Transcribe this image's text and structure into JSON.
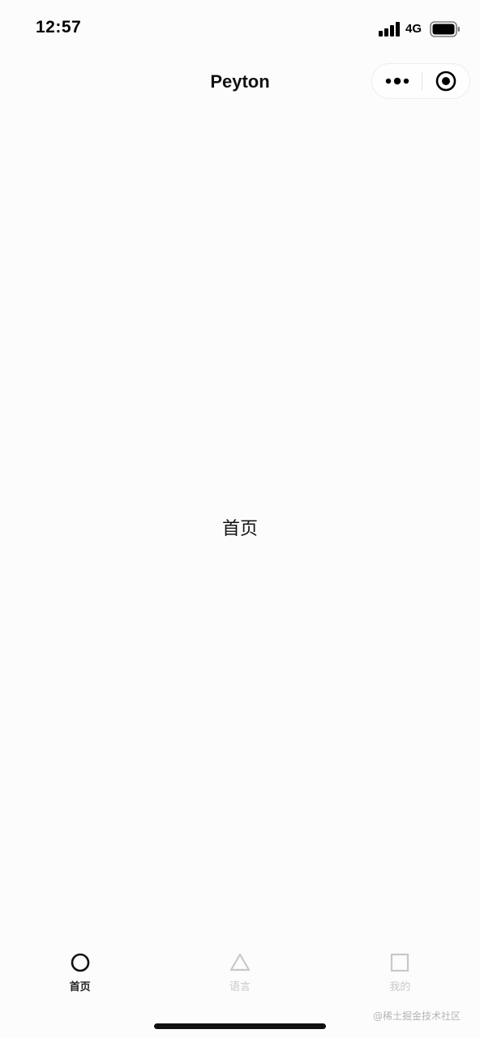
{
  "status_bar": {
    "time": "12:57",
    "network": "4G",
    "signal_icon": "cellular-signal-icon",
    "battery_icon": "battery-full-icon"
  },
  "nav_bar": {
    "title": "Peyton",
    "more_icon": "more-dots-icon",
    "close_icon": "target-circle-icon"
  },
  "main": {
    "page_label": "首页"
  },
  "tab_bar": {
    "items": [
      {
        "label": "首页",
        "icon": "circle-icon",
        "active": true
      },
      {
        "label": "语言",
        "icon": "triangle-icon",
        "active": false
      },
      {
        "label": "我的",
        "icon": "square-icon",
        "active": false
      }
    ],
    "active_color": "#222222",
    "inactive_color": "#c8c8cc"
  },
  "watermark": {
    "text": "@稀土掘金技术社区"
  }
}
